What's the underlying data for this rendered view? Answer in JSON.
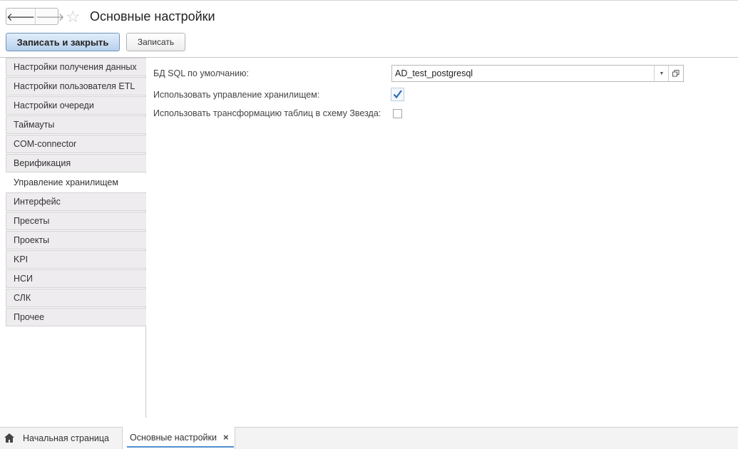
{
  "header": {
    "title": "Основные настройки",
    "back_glyph": "🡐",
    "forward_glyph": "🡒",
    "star_glyph": "☆",
    "save_close_label": "Записать и закрыть",
    "save_label": "Записать"
  },
  "sidebar": {
    "items": [
      {
        "label": "Настройки получения данных",
        "active": false
      },
      {
        "label": "Настройки пользователя ETL",
        "active": false
      },
      {
        "label": "Настройки очереди",
        "active": false
      },
      {
        "label": "Таймауты",
        "active": false
      },
      {
        "label": "COM-connector",
        "active": false
      },
      {
        "label": "Верификация",
        "active": false
      },
      {
        "label": "Управление хранилищем",
        "active": true
      },
      {
        "label": "Интерфейс",
        "active": false
      },
      {
        "label": "Пресеты",
        "active": false
      },
      {
        "label": "Проекты",
        "active": false
      },
      {
        "label": "KPI",
        "active": false
      },
      {
        "label": "НСИ",
        "active": false
      },
      {
        "label": "СЛК",
        "active": false
      },
      {
        "label": "Прочее",
        "active": false
      }
    ]
  },
  "form": {
    "db_label": "БД SQL по умолчанию:",
    "db_value": "AD_test_postgresql",
    "storage_label": "Использовать управление хранилищем:",
    "storage_checked": true,
    "star_label": "Использовать трансформацию таблиц в схему Звезда:",
    "star_checked": false
  },
  "bottom_bar": {
    "home_label": "Начальная страница",
    "active_tab_label": "Основные настройки",
    "close_glyph": "×"
  },
  "colors": {
    "accent": "#4f8fcf",
    "sidebar_bg": "#eeecee",
    "primary_button": "#b6d0ec",
    "checkmark": "#2d6fb8"
  }
}
